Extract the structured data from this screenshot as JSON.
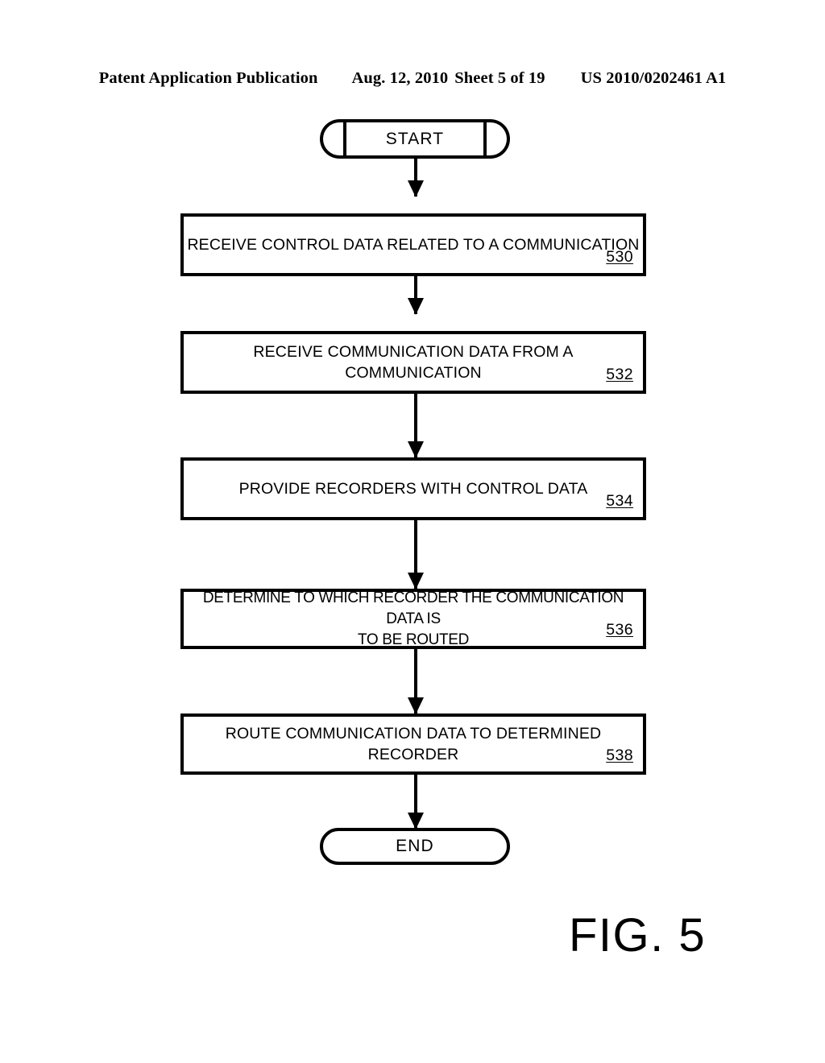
{
  "header": {
    "publication": "Patent Application Publication",
    "date": "Aug. 12, 2010",
    "sheet": "Sheet 5 of 19",
    "document_number": "US 2010/0202461 A1"
  },
  "figure": {
    "label": "FIG. 5"
  },
  "flowchart": {
    "start_label": "START",
    "end_label": "END",
    "steps": [
      {
        "text": "RECEIVE CONTROL DATA RELATED TO A COMMUNICATION",
        "ref": "530"
      },
      {
        "text": "RECEIVE COMMUNICATION DATA FROM A COMMUNICATION",
        "ref": "532"
      },
      {
        "text": "PROVIDE RECORDERS WITH CONTROL DATA",
        "ref": "534"
      },
      {
        "text": "DETERMINE TO WHICH RECORDER THE COMMUNICATION DATA IS\nTO BE ROUTED",
        "ref": "536"
      },
      {
        "text": "ROUTE COMMUNICATION DATA TO DETERMINED RECORDER",
        "ref": "538"
      }
    ]
  }
}
